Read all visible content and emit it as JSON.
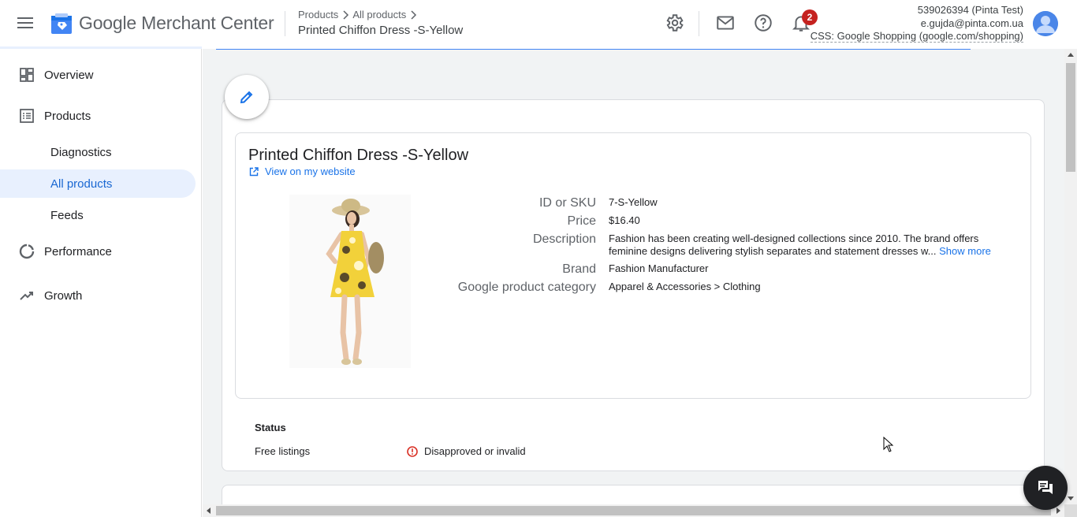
{
  "header": {
    "app_title": "Google Merchant Center",
    "breadcrumb": [
      "Products",
      "All products"
    ],
    "page_title": "Printed Chiffon Dress -S-Yellow",
    "notifications_count": "2",
    "account": {
      "id_line": "539026394 (Pinta Test)",
      "email": "e.gujda@pinta.com.ua",
      "css_line": "CSS: Google Shopping (google.com/shopping)"
    }
  },
  "sidebar": {
    "items": [
      {
        "label": "Overview",
        "icon": "dashboard-icon"
      },
      {
        "label": "Products",
        "icon": "list-icon"
      },
      {
        "label": "Diagnostics"
      },
      {
        "label": "All products",
        "active": true
      },
      {
        "label": "Feeds"
      },
      {
        "label": "Performance",
        "icon": "donut-icon"
      },
      {
        "label": "Growth",
        "icon": "trending-up-icon"
      }
    ]
  },
  "product": {
    "title": "Printed Chiffon Dress -S-Yellow",
    "view_link": "View on my website",
    "attributes": [
      {
        "label": "ID or SKU",
        "value": "7-S-Yellow"
      },
      {
        "label": "Price",
        "value": "$16.40"
      },
      {
        "label": "Description",
        "value": "Fashion has been creating well-designed collections since 2010. The brand offers feminine designs delivering stylish separates and statement dresses w..."
      },
      {
        "label": "Brand",
        "value": "Fashion Manufacturer"
      },
      {
        "label": "Google product category",
        "value": "Apparel & Accessories > Clothing"
      }
    ],
    "show_more": "Show more"
  },
  "status": {
    "title": "Status",
    "rows": [
      {
        "label": "Free listings",
        "value": "Disapproved or invalid"
      }
    ]
  },
  "colors": {
    "accent": "#1a73e8",
    "active_nav_bg": "#e8f0fe",
    "error": "#d93025",
    "badge": "#c5221f"
  }
}
